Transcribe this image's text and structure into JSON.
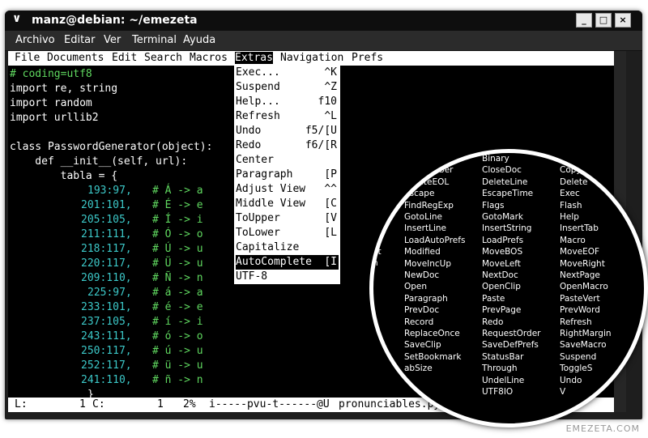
{
  "window": {
    "title": "manz@debian: ~/emezeta",
    "arrow_icon": "∨"
  },
  "menubar": [
    "Archivo",
    "Editar",
    "Ver",
    "Terminal",
    "Ayuda"
  ],
  "nano_menu": [
    "File",
    "Documents",
    "Edit",
    "Search",
    "Macros",
    "Extras",
    "Navigation",
    "Prefs"
  ],
  "code_plain": [
    "import re, string",
    "import random",
    "import urllib2",
    "",
    "class PasswordGenerator(object):",
    "    def __init__(self, url):",
    "        tabla = {"
  ],
  "code_comment": "# coding=utf8",
  "table_rows": [
    {
      "v": "193:97,",
      "c": "# Á -> a"
    },
    {
      "v": "201:101,",
      "c": "# É -> e"
    },
    {
      "v": "205:105,",
      "c": "# Í -> i"
    },
    {
      "v": "211:111,",
      "c": "# Ó -> o"
    },
    {
      "v": "218:117,",
      "c": "# Ú -> u"
    },
    {
      "v": "220:117,",
      "c": "# Ü -> u"
    },
    {
      "v": "209:110,",
      "c": "# Ñ -> n"
    },
    {
      "v": "225:97,",
      "c": "# á -> a"
    },
    {
      "v": "233:101,",
      "c": "# é -> e"
    },
    {
      "v": "237:105,",
      "c": "# í -> i"
    },
    {
      "v": "243:111,",
      "c": "# ó -> o"
    },
    {
      "v": "250:117,",
      "c": "# ú -> u"
    },
    {
      "v": "252:117,",
      "c": "# ü -> u"
    },
    {
      "v": "241:110,",
      "c": "# ñ -> n"
    }
  ],
  "close_brace": "}",
  "extras_menu": [
    {
      "label": "Exec...",
      "key": "^K"
    },
    {
      "label": "Suspend",
      "key": "^Z"
    },
    {
      "label": "Help...",
      "key": "f10"
    },
    {
      "label": "Refresh",
      "key": "^L"
    },
    {
      "label": "Undo",
      "key": "f5/[U"
    },
    {
      "label": "Redo",
      "key": "f6/[R"
    },
    {
      "label": "Center",
      "key": ""
    },
    {
      "label": "Paragraph",
      "key": "[P"
    },
    {
      "label": "Adjust View",
      "key": "^^"
    },
    {
      "label": "Middle View",
      "key": "[C"
    },
    {
      "label": "ToUpper",
      "key": "[V"
    },
    {
      "label": "ToLower",
      "key": "[L"
    },
    {
      "label": "Capitalize",
      "key": ""
    },
    {
      "label": "AutoComplete",
      "key": "[I"
    },
    {
      "label": "UTF-8",
      "key": ""
    }
  ],
  "extras_selected_index": 13,
  "status": {
    "line": "L:",
    "line_num": "1",
    "col": "C:",
    "col_num": "1",
    "pct": "2%",
    "flags": "i-----pvu-t------@U",
    "filename": "pronunciables.py"
  },
  "zoom_rows": [
    [
      "",
      "Binary",
      ""
    ],
    [
      "ackNumber",
      "CloseDoc",
      "Copy"
    ],
    [
      "DeleteEOL",
      "DeleteLine",
      "Delete"
    ],
    [
      "Escape",
      "EscapeTime",
      "Exec"
    ],
    [
      "FindRegExp",
      "Flags",
      "Flash"
    ],
    [
      "GotoLine",
      "GotoMark",
      "Help"
    ],
    [
      "InsertLine",
      "InsertString",
      "InsertTab"
    ],
    [
      "LoadAutoPrefs",
      "LoadPrefs",
      "Macro"
    ],
    [
      "Modified",
      "MoveBOS",
      "MoveEOF"
    ],
    [
      "MoveIncUp",
      "MoveLeft",
      "MoveRight"
    ],
    [
      "NewDoc",
      "NextDoc",
      "NextPage"
    ],
    [
      "Open",
      "OpenClip",
      "OpenMacro"
    ],
    [
      "Paragraph",
      "Paste",
      "PasteVert"
    ],
    [
      "PrevDoc",
      "PrevPage",
      "PrevWord"
    ],
    [
      "Record",
      "Redo",
      "Refresh"
    ],
    [
      "ReplaceOnce",
      "RequestOrder",
      "RightMargin"
    ],
    [
      "SaveClip",
      "SaveDefPrefs",
      "SaveMacro"
    ],
    [
      "SetBookmark",
      "StatusBar",
      "Suspend"
    ],
    [
      "abSize",
      "Through",
      "ToggleS"
    ],
    [
      "",
      "UndelLine",
      "Undo"
    ],
    [
      "",
      "UTF8IO",
      "V"
    ]
  ],
  "zoom_partial": [
    "et",
    "n"
  ],
  "watermark": "EMEZETA.COM"
}
